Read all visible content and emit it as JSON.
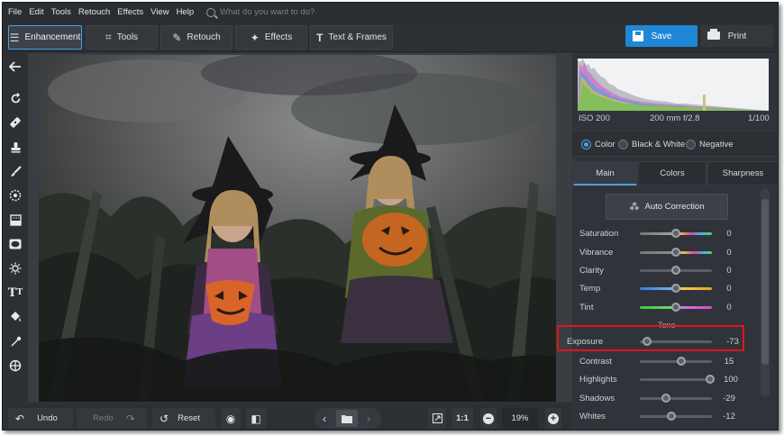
{
  "menu": [
    "File",
    "Edit",
    "Tools",
    "Retouch",
    "Effects",
    "View",
    "Help"
  ],
  "search": {
    "placeholder": "What do you want to do?"
  },
  "tabs": [
    {
      "label": "Enhancement",
      "icon": "sliders-icon",
      "active": true
    },
    {
      "label": "Tools",
      "icon": "crop-icon"
    },
    {
      "label": "Retouch",
      "icon": "brush-icon"
    },
    {
      "label": "Effects",
      "icon": "magic-wand-icon"
    },
    {
      "label": "Text & Frames",
      "icon": "text-icon"
    }
  ],
  "actions": {
    "save": "Save",
    "print": "Print"
  },
  "left_tools": [
    "back-arrow-icon",
    "rotate-icon",
    "healing-icon",
    "stamp-icon",
    "brush-icon",
    "radial-icon",
    "gradient-icon",
    "vignette-icon",
    "light-icon",
    "text-icon",
    "fill-icon",
    "color-picker-icon",
    "target-icon"
  ],
  "info": {
    "iso": "ISO 200",
    "focal": "200 mm f/2.8",
    "shutter": "1/100"
  },
  "modes": [
    {
      "label": "Color",
      "selected": true
    },
    {
      "label": "Black & White",
      "selected": false
    },
    {
      "label": "Negative",
      "selected": false
    }
  ],
  "panel_tabs": [
    {
      "label": "Main",
      "active": true
    },
    {
      "label": "Colors",
      "active": false
    },
    {
      "label": "Sharpness",
      "active": false
    }
  ],
  "auto_correction": "Auto Correction",
  "tone_heading": "Tone",
  "color_sliders": [
    {
      "label": "Saturation",
      "value": "0",
      "gradient": "saturation"
    },
    {
      "label": "Vibrance",
      "value": "0",
      "gradient": "vibrance"
    },
    {
      "label": "Clarity",
      "value": "0",
      "gradient": "clarity"
    },
    {
      "label": "Temp",
      "value": "0",
      "gradient": "temp"
    },
    {
      "label": "Tint",
      "value": "0",
      "gradient": "tint"
    }
  ],
  "tone_sliders": [
    {
      "label": "Exposure",
      "value": "-73",
      "level": 0.1
    },
    {
      "label": "Contrast",
      "value": "15",
      "level": 0.57
    },
    {
      "label": "Highlights",
      "value": "100",
      "level": 0.97
    },
    {
      "label": "Shadows",
      "value": "-29",
      "level": 0.36
    },
    {
      "label": "Whites",
      "value": "-12",
      "level": 0.44
    }
  ],
  "bottom": {
    "undo": "Undo",
    "redo": "Redo",
    "reset": "Reset",
    "ratio": "1:1",
    "zoom": "19%"
  },
  "colors": {
    "accent": "#1e88d6",
    "highlight": "#e0141e"
  }
}
